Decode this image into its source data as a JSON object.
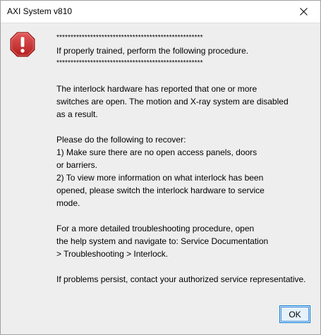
{
  "window": {
    "title": "AXI System v810"
  },
  "dialog": {
    "icon": "error-icon",
    "icon_color": "#c42b2b",
    "lines": [
      "****************************************************",
      "If properly trained, perform the following procedure.",
      "****************************************************",
      "",
      "The interlock hardware has reported that one or more",
      "switches are open. The motion and X-ray system are disabled",
      "as a result.",
      "",
      "Please do the following to recover:",
      "1) Make sure there are no open access panels, doors",
      "or barriers.",
      "2) To view more information on what interlock has been",
      "opened, please switch the interlock hardware to service",
      "mode.",
      "",
      "For a more detailed troubleshooting procedure, open",
      "the help system and navigate to: Service Documentation",
      "> Troubleshooting > Interlock.",
      "",
      "If problems persist, contact your authorized service representative."
    ],
    "ok_label": "OK"
  }
}
